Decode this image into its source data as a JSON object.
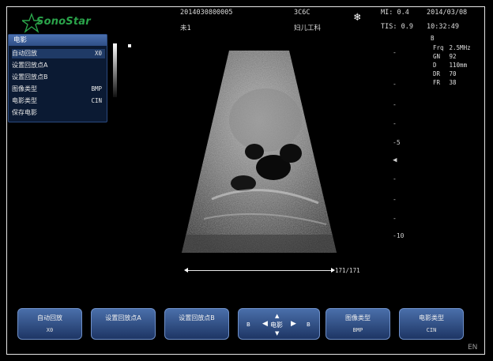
{
  "header": {
    "brand": "SonoStar",
    "patient_id": "2014030800005",
    "patient_name": "未1",
    "exam_code": "3C6C",
    "exam_type": "妇儿工科",
    "mi": "MI: 0.4",
    "tis": "TIS: 0.9",
    "date": "2014/03/08",
    "time": "10:32:49",
    "freeze_icon": "snowflake-icon"
  },
  "menu": {
    "title": "电影",
    "items": [
      {
        "label": "自动回放",
        "value": "X0"
      },
      {
        "label": "设置回放点A",
        "value": ""
      },
      {
        "label": "设置回放点B",
        "value": ""
      },
      {
        "label": "图像类型",
        "value": "BMP"
      },
      {
        "label": "电影类型",
        "value": "CIN"
      },
      {
        "label": "保存电影",
        "value": ""
      }
    ]
  },
  "params": {
    "mode": "B",
    "rows": [
      {
        "k": "Frq",
        "v": "2.5MHz"
      },
      {
        "k": "GN",
        "v": "92"
      },
      {
        "k": "D",
        "v": "110mm"
      },
      {
        "k": "DR",
        "v": "70"
      },
      {
        "k": "FR",
        "v": "38"
      }
    ]
  },
  "depth_scale": {
    "mark_5": "5",
    "mark_10": "10"
  },
  "cine": {
    "frame": "171/171"
  },
  "softkeys": [
    {
      "label": "自动回放",
      "value": "X0"
    },
    {
      "label": "设置回放点A",
      "value": ""
    },
    {
      "label": "设置回放点B",
      "value": ""
    },
    {
      "label": "电影",
      "value": "",
      "left": "B",
      "right": "B"
    },
    {
      "label": "图像类型",
      "value": "BMP"
    },
    {
      "label": "电影类型",
      "value": "CIN"
    }
  ],
  "lang": "EN"
}
